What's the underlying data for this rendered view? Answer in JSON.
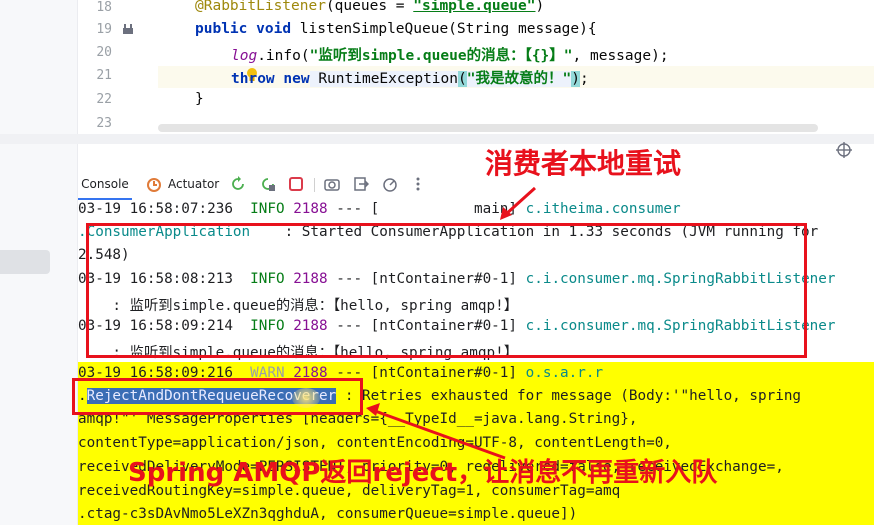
{
  "editor": {
    "lines": [
      {
        "num": "18"
      },
      {
        "num": "19"
      },
      {
        "num": "20"
      },
      {
        "num": "21"
      },
      {
        "num": "22"
      },
      {
        "num": "23"
      }
    ],
    "line18": {
      "annotation": "@RabbitListener",
      "paren_open": "(queues = ",
      "value": "\"simple.queue\"",
      "paren_close": ")"
    },
    "line19": {
      "kw1": "public",
      "kw2": "void",
      "rest": " listenSimpleQueue(String message){"
    },
    "line20": {
      "field": "log",
      "call": ".info(",
      "str": "\"监听到simple.queue的消息：【{}】\"",
      "tail": ", message);"
    },
    "line21": {
      "kw1": "throw",
      "kw2": "new",
      "cls": " RuntimeException",
      "lp": "(",
      "str": "\"我是故意的！\"",
      "rp": ")",
      "semi": ";"
    },
    "line22": {
      "text": "}"
    }
  },
  "toolwindow": {
    "console_tab": "Console",
    "actuator_tab": "Actuator"
  },
  "console": {
    "l1": {
      "ts": "03-19 16:58:07:236",
      "lvl": "INFO",
      "pid": "2188",
      "sep": " --- [",
      "thread": "           main] ",
      "logger": "c.itheima.consumer"
    },
    "l2": {
      "logger": ".ConsumerApplication",
      "msg": "    : Started ConsumerApplication in 1.33 seconds (JVM running for"
    },
    "l3": {
      "text": "2.548)"
    },
    "l4": {
      "ts": "03-19 16:58:08:213",
      "lvl": "INFO",
      "pid": "2188",
      "sep": " --- [ntContainer#0-1] ",
      "logger": "c.i.consumer.mq.SpringRabbitListener"
    },
    "l5": {
      "text": "    : 监听到simple.queue的消息：【hello, spring amqp!】"
    },
    "l6": {
      "ts": "03-19 16:58:09:214",
      "lvl": "INFO",
      "pid": "2188",
      "sep": " --- [ntContainer#0-1] ",
      "logger": "c.i.consumer.mq.SpringRabbitListener"
    },
    "l7": {
      "text": "    : 监听到simple.queue的消息：【hello, spring amqp!】"
    },
    "l8": {
      "ts": "03-19 16:58:09:216",
      "lvl": "WARN",
      "pid": "2188",
      "sep": " --- [ntContainer#0-1] ",
      "logger": "o.s.a.r.r"
    },
    "l9": {
      "pre": ".",
      "sel": "RejectAndDontRequeueRecoverer",
      "msg": " : Retries exhausted for message (Body:'\"hello, spring"
    },
    "l10": {
      "text": "amqp!\"' MessageProperties [headers={__TypeId__=java.lang.String},"
    },
    "l11": {
      "text": "contentType=application/json, contentEncoding=UTF-8, contentLength=0,"
    },
    "l12": {
      "text": "receivedDeliveryMode=PERSISTENT, priority=0, redelivered=false, receivedExchange=,"
    },
    "l13": {
      "text": "receivedRoutingKey=simple.queue, deliveryTag=1, consumerTag=amq"
    },
    "l14": {
      "text": ".ctag-c3sDAvNmo5LeXZn3qghduA, consumerQueue=simple.queue])"
    }
  },
  "annotations": {
    "local_retry": "消费者本地重试",
    "reject_note": "Spring AMQP返回reject，让消息不再重新入队",
    "color": "#e8111c"
  }
}
